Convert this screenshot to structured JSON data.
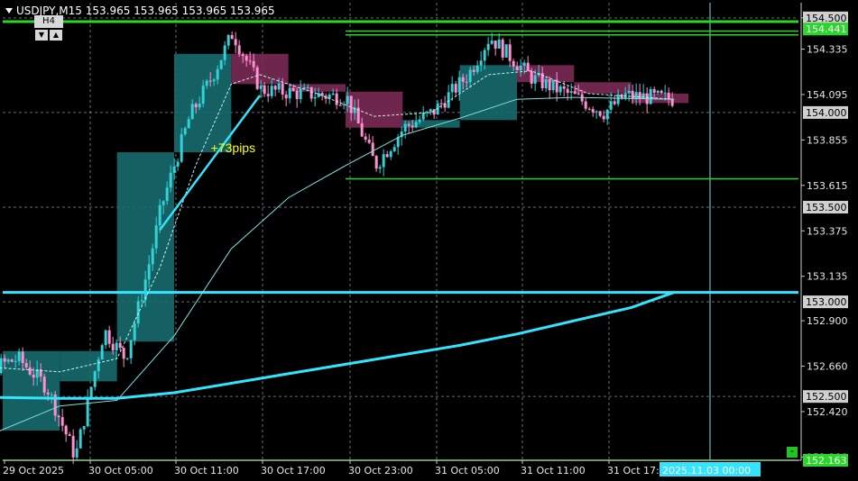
{
  "header": {
    "symbol_line": "USDJPY,M15  153.965 153.965 153.965 153.965"
  },
  "timeframe_panel": {
    "label": "H4",
    "down_btn": "▼",
    "up_btn": "▲"
  },
  "annotation": "+73pips",
  "expand_button": "-",
  "colors": {
    "background": "#000000",
    "bull_candle": "#32d2d6",
    "bear_candle": "#ff8fcf",
    "bull_box": "#176a6e",
    "bear_box": "#7a2a55",
    "ma_fast": "#c8f4f4",
    "ma_mid": "#7fe0e0",
    "ma_slow": "#33e4ff",
    "level_green": "#2ad62a",
    "level_cyan": "#33e4ff",
    "grid": "#c8c8c8"
  },
  "chart_data": {
    "type": "candlestick",
    "symbol": "USDJPY",
    "timeframe": "M15",
    "last_price": 153.965,
    "ylim": [
      152.163,
      154.58
    ],
    "y_ticks": [
      154.5,
      154.335,
      154.095,
      153.855,
      153.615,
      153.375,
      153.135,
      152.9,
      152.66,
      152.42,
      152.18
    ],
    "price_labels": [
      {
        "value": 154.5,
        "label": "154.500",
        "style": "grid"
      },
      {
        "value": 154.441,
        "label": "154.441",
        "style": "green"
      },
      {
        "value": 154.0,
        "label": "154.000",
        "style": "grid"
      },
      {
        "value": 153.5,
        "label": "153.500",
        "style": "grid"
      },
      {
        "value": 153.0,
        "label": "153.000",
        "style": "grid"
      },
      {
        "value": 152.5,
        "label": "152.500",
        "style": "grid"
      },
      {
        "value": 152.163,
        "label": "152.163",
        "style": "green"
      }
    ],
    "x_labels": [
      "29 Oct 2025",
      "30 Oct 05:00",
      "30 Oct 11:00",
      "30 Oct 17:00",
      "30 Oct 23:00",
      "31 Oct 05:00",
      "31 Oct 11:00",
      "31 Oct 17:00"
    ],
    "current_time_label": "2025.11.03 00:00",
    "grid": true,
    "h4_boxes": [
      {
        "start": "29 Oct 23:00",
        "end": "30 Oct 03:00",
        "open": 152.32,
        "close": 152.74,
        "direction": "bull"
      },
      {
        "start": "30 Oct 03:00",
        "end": "30 Oct 07:00",
        "open": 152.58,
        "close": 152.74,
        "direction": "bull"
      },
      {
        "start": "30 Oct 07:00",
        "end": "30 Oct 11:00",
        "open": 152.79,
        "close": 153.79,
        "direction": "bull"
      },
      {
        "start": "30 Oct 11:00",
        "end": "30 Oct 15:00",
        "open": 153.79,
        "close": 154.31,
        "direction": "bull"
      },
      {
        "start": "30 Oct 15:00",
        "end": "30 Oct 19:00",
        "open": 154.31,
        "close": 154.15,
        "direction": "bear"
      },
      {
        "start": "30 Oct 19:00",
        "end": "30 Oct 23:00",
        "open": 154.15,
        "close": 154.11,
        "direction": "bear"
      },
      {
        "start": "30 Oct 23:00",
        "end": "31 Oct 03:00",
        "open": 154.11,
        "close": 153.92,
        "direction": "bear"
      },
      {
        "start": "31 Oct 03:00",
        "end": "31 Oct 07:00",
        "open": 153.92,
        "close": 153.96,
        "direction": "bull"
      },
      {
        "start": "31 Oct 07:00",
        "end": "31 Oct 11:00",
        "open": 153.96,
        "close": 154.25,
        "direction": "bull"
      },
      {
        "start": "31 Oct 11:00",
        "end": "31 Oct 15:00",
        "open": 154.25,
        "close": 154.16,
        "direction": "bear"
      },
      {
        "start": "31 Oct 15:00",
        "end": "31 Oct 19:00",
        "open": 154.16,
        "close": 154.1,
        "direction": "bear"
      },
      {
        "start": "31 Oct 19:00",
        "end": "31 Oct 23:00",
        "open": 154.1,
        "close": 154.05,
        "direction": "bear"
      }
    ],
    "candle_path": [
      {
        "time": "29 Oct 19:00",
        "price": 152.96
      },
      {
        "time": "29 Oct 21:00",
        "price": 152.62
      },
      {
        "time": "30 Oct 00:00",
        "price": 152.7
      },
      {
        "time": "30 Oct 02:00",
        "price": 152.55
      },
      {
        "time": "30 Oct 04:00",
        "price": 152.18
      },
      {
        "time": "30 Oct 06:00",
        "price": 152.85
      },
      {
        "time": "30 Oct 07:30",
        "price": 152.7
      },
      {
        "time": "30 Oct 09:00",
        "price": 153.15
      },
      {
        "time": "30 Oct 10:00",
        "price": 153.5
      },
      {
        "time": "30 Oct 12:00",
        "price": 153.98
      },
      {
        "time": "30 Oct 13:30",
        "price": 154.18
      },
      {
        "time": "30 Oct 15:00",
        "price": 154.42
      },
      {
        "time": "30 Oct 17:00",
        "price": 154.12
      },
      {
        "time": "30 Oct 20:00",
        "price": 154.1
      },
      {
        "time": "30 Oct 23:00",
        "price": 154.08
      },
      {
        "time": "31 Oct 01:00",
        "price": 153.72
      },
      {
        "time": "31 Oct 03:00",
        "price": 153.92
      },
      {
        "time": "31 Oct 05:00",
        "price": 154.0
      },
      {
        "time": "31 Oct 07:30",
        "price": 154.2
      },
      {
        "time": "31 Oct 09:00",
        "price": 154.4
      },
      {
        "time": "31 Oct 12:00",
        "price": 154.18
      },
      {
        "time": "31 Oct 15:00",
        "price": 154.08
      },
      {
        "time": "31 Oct 17:00",
        "price": 154.0
      },
      {
        "time": "31 Oct 18:30",
        "price": 154.09
      },
      {
        "time": "31 Oct 22:00",
        "price": 154.07
      }
    ],
    "ma_fast": [
      {
        "time": "29 Oct 19:00",
        "price": 152.67
      },
      {
        "time": "30 Oct 03:00",
        "price": 152.63
      },
      {
        "time": "30 Oct 07:00",
        "price": 152.7
      },
      {
        "time": "30 Oct 10:00",
        "price": 153.18
      },
      {
        "time": "30 Oct 12:30",
        "price": 153.72
      },
      {
        "time": "30 Oct 15:00",
        "price": 154.15
      },
      {
        "time": "30 Oct 17:00",
        "price": 154.2
      },
      {
        "time": "30 Oct 21:00",
        "price": 154.1
      },
      {
        "time": "31 Oct 01:00",
        "price": 153.98
      },
      {
        "time": "31 Oct 05:00",
        "price": 154.0
      },
      {
        "time": "31 Oct 09:00",
        "price": 154.2
      },
      {
        "time": "31 Oct 12:00",
        "price": 154.22
      },
      {
        "time": "31 Oct 16:00",
        "price": 154.1
      },
      {
        "time": "31 Oct 22:00",
        "price": 154.07
      }
    ],
    "ma_mid": [
      {
        "time": "29 Oct 19:00",
        "price": 152.2
      },
      {
        "time": "30 Oct 03:00",
        "price": 152.45
      },
      {
        "time": "30 Oct 07:00",
        "price": 152.48
      },
      {
        "time": "30 Oct 11:00",
        "price": 152.82
      },
      {
        "time": "30 Oct 15:00",
        "price": 153.28
      },
      {
        "time": "30 Oct 19:00",
        "price": 153.55
      },
      {
        "time": "30 Oct 23:00",
        "price": 153.72
      },
      {
        "time": "31 Oct 03:00",
        "price": 153.88
      },
      {
        "time": "31 Oct 07:00",
        "price": 153.97
      },
      {
        "time": "31 Oct 11:00",
        "price": 154.07
      },
      {
        "time": "31 Oct 15:00",
        "price": 154.08
      },
      {
        "time": "31 Oct 22:00",
        "price": 154.07
      }
    ],
    "ma_slow": [
      {
        "time": "29 Oct 19:00",
        "price": 152.5
      },
      {
        "time": "30 Oct 03:00",
        "price": 152.49
      },
      {
        "time": "30 Oct 07:00",
        "price": 152.49
      },
      {
        "time": "30 Oct 11:00",
        "price": 152.52
      },
      {
        "time": "30 Oct 15:00",
        "price": 152.57
      },
      {
        "time": "30 Oct 19:00",
        "price": 152.62
      },
      {
        "time": "30 Oct 23:00",
        "price": 152.67
      },
      {
        "time": "31 Oct 03:00",
        "price": 152.72
      },
      {
        "time": "31 Oct 07:00",
        "price": 152.77
      },
      {
        "time": "31 Oct 11:00",
        "price": 152.83
      },
      {
        "time": "31 Oct 15:00",
        "price": 152.9
      },
      {
        "time": "31 Oct 19:00",
        "price": 152.97
      },
      {
        "time": "31 Oct 22:00",
        "price": 153.05
      }
    ],
    "h_lines": [
      {
        "value": 154.48,
        "color": "green",
        "thick": true
      },
      {
        "value": 154.43,
        "color": "green",
        "from": "30 Oct 23:00"
      },
      {
        "value": 154.41,
        "color": "green",
        "from": "30 Oct 23:00"
      },
      {
        "value": 153.65,
        "color": "green",
        "from": "30 Oct 23:00"
      },
      {
        "value": 153.05,
        "color": "cyan",
        "thick": true
      },
      {
        "value": 152.163,
        "color": "green"
      }
    ],
    "trend_line": {
      "from": {
        "time": "30 Oct 10:00",
        "price": 153.38
      },
      "to": {
        "time": "30 Oct 17:00",
        "price": 154.09
      },
      "label": "+73pips"
    }
  }
}
